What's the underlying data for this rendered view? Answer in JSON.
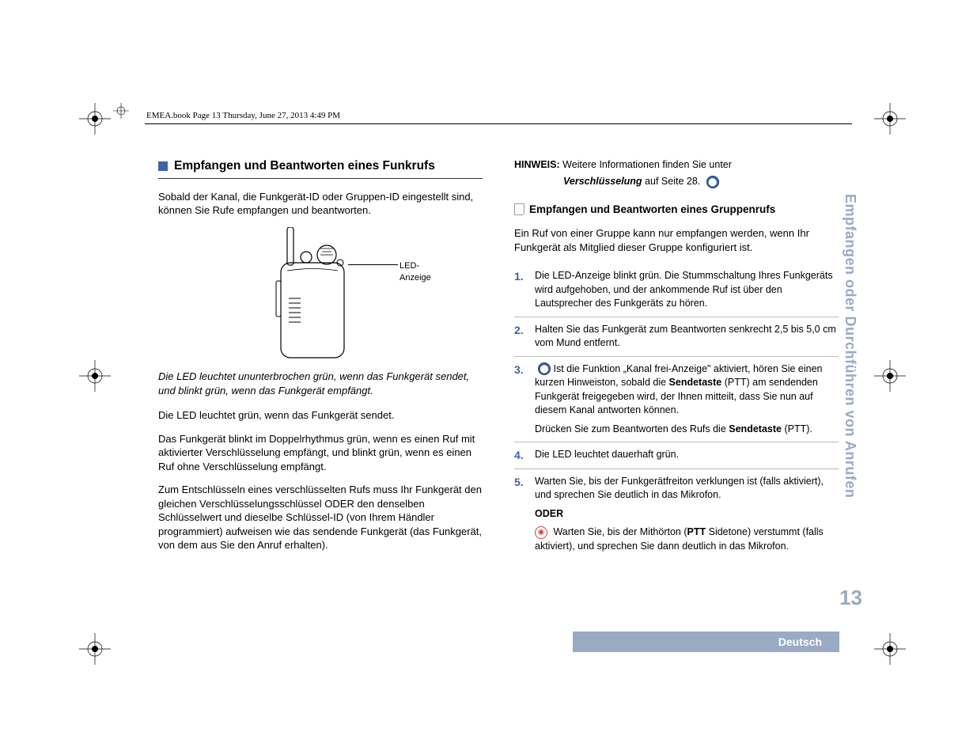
{
  "meta": {
    "headerText": "EMEA.book  Page 13  Thursday, June 27, 2013  4:49 PM"
  },
  "sidebar": {
    "chapterTitle": "Empfangen oder Durchführen von Anrufen",
    "pageNumber": "13",
    "language": "Deutsch"
  },
  "leftCol": {
    "heading": "Empfangen und Beantworten eines Funkrufs",
    "introPara": "Sobald der Kanal, die Funkgerät-ID oder Gruppen-ID eingestellt sind, können Sie Rufe empfangen und beantworten.",
    "figure": {
      "ledLabel": "LED-Anzeige"
    },
    "caption": "Die LED leuchtet ununterbrochen grün, wenn das Funkgerät sendet, und blinkt grün, wenn das Funkgerät empfängt.",
    "para1": "Die LED leuchtet grün, wenn das Funkgerät sendet.",
    "para2": "Das Funkgerät blinkt im Doppelrhythmus grün, wenn es einen Ruf mit aktivierter Verschlüsselung empfängt, und blinkt grün, wenn es einen Ruf ohne Verschlüsselung empfängt.",
    "para3": "Zum Entschlüsseln eines verschlüsselten Rufs muss Ihr Funkgerät den gleichen Verschlüsselungsschlüssel ODER den denselben Schlüsselwert und dieselbe Schlüssel-ID (von Ihrem Händler programmiert) aufweisen wie das sendende Funkgerät (das Funkgerät, von dem aus Sie den Anruf erhalten)."
  },
  "rightCol": {
    "noteLabel": "HINWEIS:",
    "noteTextA": "Weitere Informationen finden Sie unter",
    "noteLink": "Verschlüsselung",
    "noteTextB": " auf Seite 28.",
    "subheading": "Empfangen und Beantworten eines Gruppenrufs",
    "introPara": "Ein Ruf von einer Gruppe kann nur empfangen werden, wenn Ihr Funkgerät als Mitglied dieser Gruppe konfiguriert ist.",
    "steps": [
      {
        "num": "1.",
        "body": "Die LED-Anzeige blinkt grün. Die Stummschaltung Ihres Funkgeräts wird aufgehoben, und der ankommende Ruf ist über den Lautsprecher des Funkgeräts zu hören."
      },
      {
        "num": "2.",
        "body": "Halten Sie das Funkgerät zum Beantworten senkrecht 2,5 bis 5,0 cm vom Mund entfernt."
      },
      {
        "num": "3.",
        "seg1": " Ist die Funktion „Kanal frei-Anzeige\" aktiviert, hören Sie einen kurzen Hinweiston, sobald die ",
        "ptt1": "Sendetaste",
        "seg2": " (PTT) am sendenden Funkgerät freigegeben wird, der Ihnen mitteilt, dass Sie nun auf diesem Kanal antworten können.",
        "seg3": "Drücken Sie zum Beantworten des Rufs die ",
        "ptt2": "Sendetaste",
        "seg4": " (PTT)."
      },
      {
        "num": "4.",
        "body": "Die LED leuchtet dauerhaft grün."
      },
      {
        "num": "5.",
        "seg1": "Warten Sie, bis der Funkgerätfreiton verklungen ist (falls aktiviert), und sprechen Sie deutlich in das Mikrofon.",
        "oder": "ODER",
        "seg2a": " Warten Sie, bis der Mithörton (",
        "ptt": "PTT",
        "seg2b": " Sidetone) verstummt (falls aktiviert), und sprechen Sie dann deutlich in das Mikrofon."
      }
    ]
  }
}
